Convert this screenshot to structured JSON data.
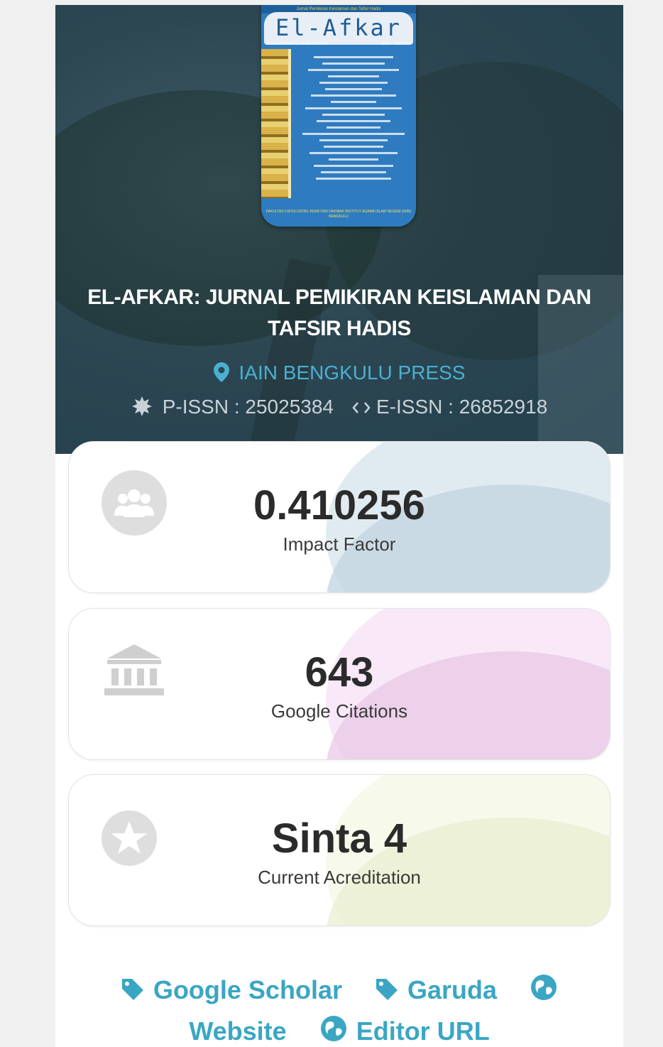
{
  "cover": {
    "top_text": "Jurnal Pemikiran Keislaman dan Tafsir Hadis",
    "title": "El-Afkar",
    "volume": "Volume 9, Nomor 1, Januari-Juni 2020",
    "issn": "ISSN : 2502-5384",
    "footer": "FAKULTAS USHULUDDIN, ADAB DAN DAKWAH INSTITUT AGAMA ISLAM NEGERI (IAIN) BENGKULU"
  },
  "journal": {
    "title": "EL-AFKAR: JURNAL PEMIKIRAN KEISLAMAN DAN TAFSIR HADIS",
    "publisher": "IAIN BENGKULU PRESS",
    "p_issn": "P-ISSN : 25025384",
    "e_issn": "E-ISSN : 26852918"
  },
  "metrics": [
    {
      "value": "0.410256",
      "label": "Impact Factor",
      "icon": "users-icon"
    },
    {
      "value": "643",
      "label": "Google Citations",
      "icon": "institution-icon"
    },
    {
      "value": "Sinta 4",
      "label": "Current Acreditation",
      "icon": "star-icon"
    }
  ],
  "links": {
    "google_scholar": "Google Scholar",
    "garuda": "Garuda",
    "website": "Website",
    "editor_url": "Editor URL"
  },
  "colors": {
    "accent": "#3aa6c3",
    "hero_bg": "#2c4652",
    "cover_blue": "#2f7bc0"
  }
}
